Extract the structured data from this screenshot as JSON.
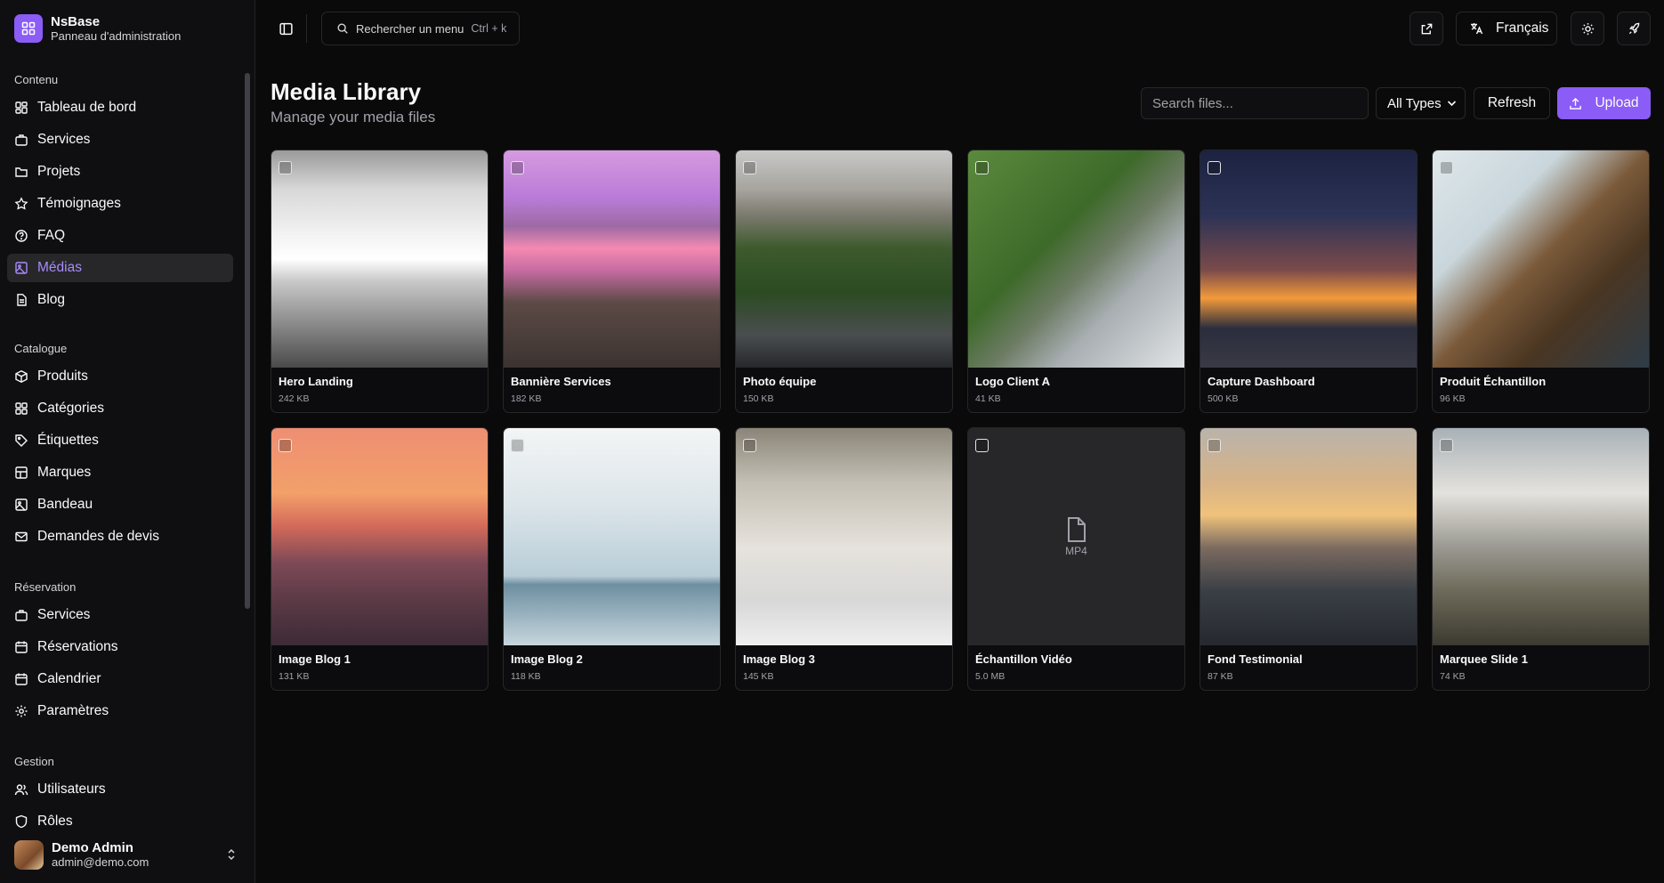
{
  "brand": {
    "name": "NsBase",
    "subtitle": "Panneau d'administration"
  },
  "sidebar": {
    "sections": [
      {
        "title": "Contenu",
        "items": [
          {
            "label": "Tableau de bord",
            "icon": "dashboard-icon"
          },
          {
            "label": "Services",
            "icon": "briefcase-icon"
          },
          {
            "label": "Projets",
            "icon": "folder-icon"
          },
          {
            "label": "Témoignages",
            "icon": "star-icon"
          },
          {
            "label": "FAQ",
            "icon": "help-circle-icon"
          },
          {
            "label": "Médias",
            "icon": "image-icon",
            "active": true
          },
          {
            "label": "Blog",
            "icon": "file-text-icon"
          }
        ]
      },
      {
        "title": "Catalogue",
        "items": [
          {
            "label": "Produits",
            "icon": "package-icon"
          },
          {
            "label": "Catégories",
            "icon": "grid-icon"
          },
          {
            "label": "Étiquettes",
            "icon": "tag-icon"
          },
          {
            "label": "Marques",
            "icon": "layers-icon"
          },
          {
            "label": "Bandeau",
            "icon": "image-icon"
          },
          {
            "label": "Demandes de devis",
            "icon": "mail-icon"
          }
        ]
      },
      {
        "title": "Réservation",
        "items": [
          {
            "label": "Services",
            "icon": "briefcase-icon"
          },
          {
            "label": "Réservations",
            "icon": "calendar-icon"
          },
          {
            "label": "Calendrier",
            "icon": "calendar-icon"
          },
          {
            "label": "Paramètres",
            "icon": "gear-icon"
          }
        ]
      },
      {
        "title": "Gestion",
        "items": [
          {
            "label": "Utilisateurs",
            "icon": "users-icon"
          },
          {
            "label": "Rôles",
            "icon": "shield-icon"
          }
        ]
      }
    ]
  },
  "user": {
    "name": "Demo Admin",
    "email": "admin@demo.com"
  },
  "topbar": {
    "search_label": "Rechercher un menu",
    "search_shortcut": "Ctrl + k",
    "language": "Français"
  },
  "page": {
    "title": "Media Library",
    "subtitle": "Manage your media files",
    "search_placeholder": "Search files...",
    "type_filter": "All Types",
    "refresh_label": "Refresh",
    "upload_label": "Upload"
  },
  "files": [
    {
      "name": "Hero Landing",
      "size": "242 KB"
    },
    {
      "name": "Bannière Services",
      "size": "182 KB"
    },
    {
      "name": "Photo équipe",
      "size": "150 KB"
    },
    {
      "name": "Logo Client A",
      "size": "41 KB"
    },
    {
      "name": "Capture Dashboard",
      "size": "500 KB"
    },
    {
      "name": "Produit Échantillon",
      "size": "96 KB"
    },
    {
      "name": "Image Blog 1",
      "size": "131 KB"
    },
    {
      "name": "Image Blog 2",
      "size": "118 KB"
    },
    {
      "name": "Image Blog 3",
      "size": "145 KB"
    },
    {
      "name": "Échantillon Vidéo",
      "size": "5.0 MB",
      "type_label": "MP4"
    },
    {
      "name": "Fond Testimonial",
      "size": "87 KB"
    },
    {
      "name": "Marquee Slide 1",
      "size": "74 KB"
    }
  ],
  "colors": {
    "accent": "#8b5cf6",
    "background": "#0a0a0b",
    "border": "#27272a"
  }
}
